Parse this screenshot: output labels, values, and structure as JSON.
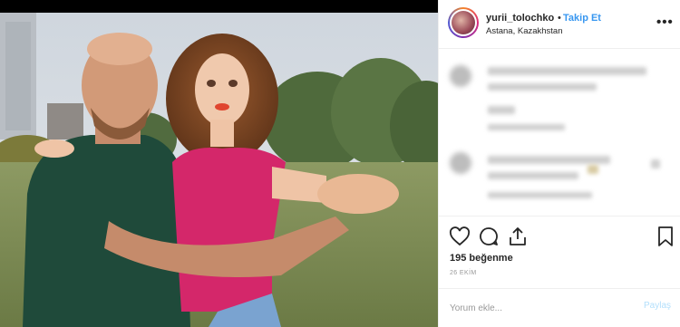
{
  "post": {
    "username": "yurii_tolochko",
    "separator": "•",
    "follow_label": "Takip Et",
    "location": "Astana, Kazakhstan",
    "more_label": "•••"
  },
  "engagement": {
    "likes_text": "195 beğenme",
    "date_text": "26 EKİM"
  },
  "comment_bar": {
    "placeholder": "Yorum ekle...",
    "post_label": "Paylaş"
  },
  "icons": [
    "heart-icon",
    "comment-icon",
    "share-icon",
    "bookmark-icon",
    "more-options-icon"
  ],
  "colors": {
    "link_blue": "#3897f0",
    "post_disabled": "#b2dffc",
    "divider": "#efefef"
  }
}
